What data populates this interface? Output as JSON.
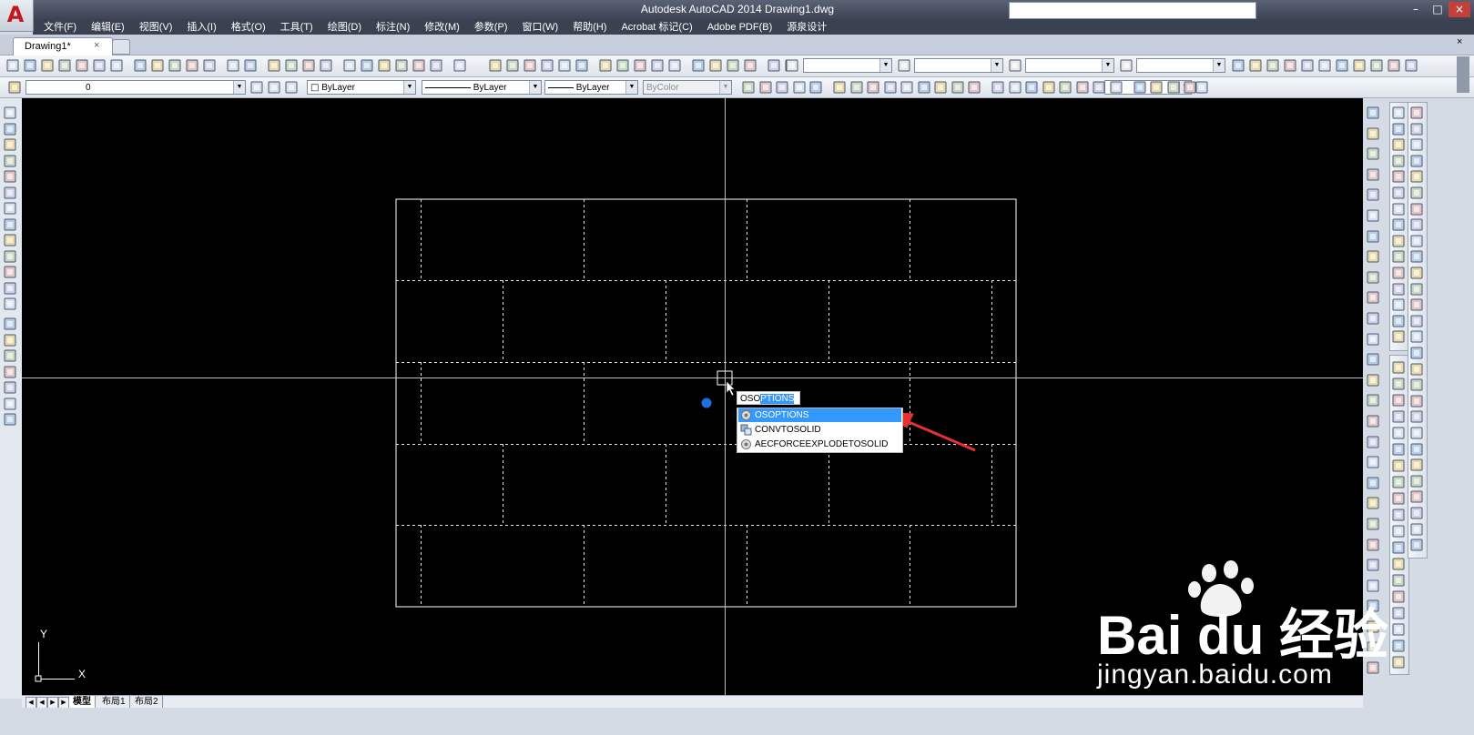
{
  "window": {
    "title": "Autodesk AutoCAD 2014    Drawing1.dwg",
    "app_icon": "A"
  },
  "menu": [
    "文件(F)",
    "编辑(E)",
    "视图(V)",
    "插入(I)",
    "格式(O)",
    "工具(T)",
    "绘图(D)",
    "标注(N)",
    "修改(M)",
    "参数(P)",
    "窗口(W)",
    "帮助(H)",
    "Acrobat 标记(C)",
    "Adobe PDF(B)",
    "源泉设计"
  ],
  "doc_tab": {
    "label": "Drawing1*",
    "close": "×"
  },
  "layer_toolbar": {
    "layer": "0",
    "color": "ByLayer",
    "linetype": "ByLayer",
    "lineweight": "ByLayer",
    "plotstyle": "ByColor"
  },
  "command": {
    "typed": "OSO",
    "completion": "PTIONS",
    "suggestions": [
      {
        "label": "OSOPTIONS",
        "icon": "gear-icon",
        "selected": true
      },
      {
        "label": "CONVTOSOLID",
        "icon": "convert-solid-icon",
        "selected": false
      },
      {
        "label": "AECFORCEEXPLODETOSOLID",
        "icon": "gear-icon",
        "selected": false
      }
    ]
  },
  "ucs": {
    "x": "X",
    "y": "Y"
  },
  "layout_tabs": [
    "模型",
    "布局1",
    "布局2"
  ],
  "watermark": {
    "brand": "Bai du 经验",
    "url": "jingyan.baidu.com"
  },
  "colors": {
    "canvas": "#000000",
    "accent_blue": "#3399ff",
    "arrow_red": "#e8312f",
    "title_bar": "#3c4252"
  }
}
